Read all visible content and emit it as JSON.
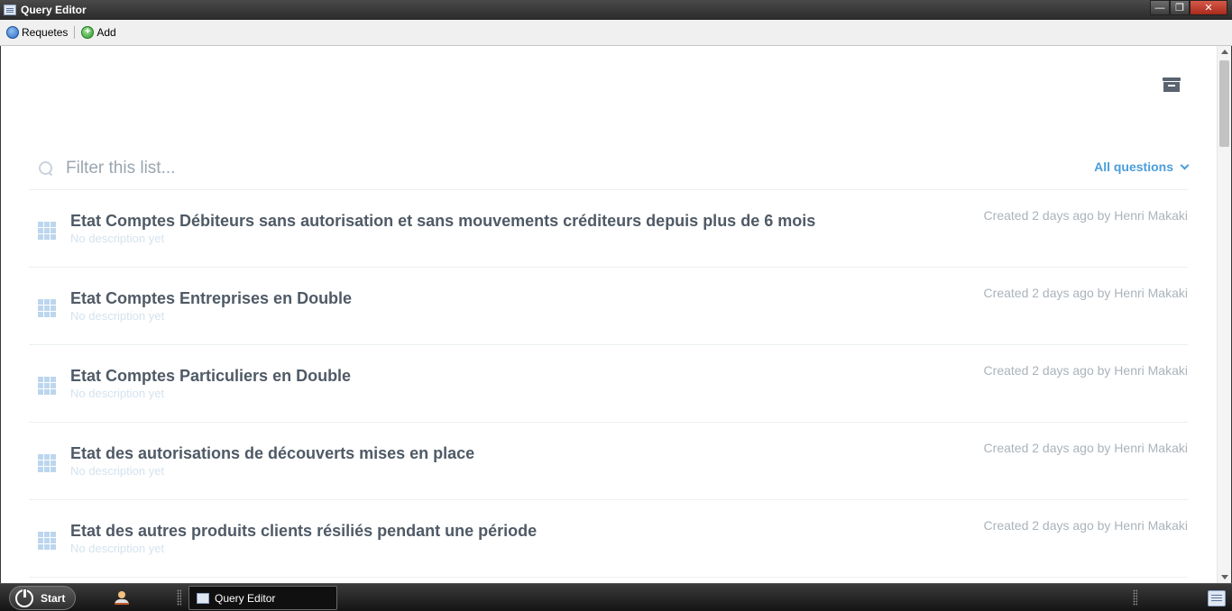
{
  "window": {
    "title": "Query Editor",
    "controls": {
      "minimize": "—",
      "restore": "❐",
      "close": "✕"
    }
  },
  "toolbar": {
    "refresh_label": "Requetes",
    "add_label": "Add",
    "add_glyph": "+"
  },
  "filter": {
    "placeholder": "Filter this list...",
    "dropdown_label": "All questions"
  },
  "questions": [
    {
      "title": "Etat Comptes Débiteurs sans autorisation et sans mouvements créditeurs depuis plus de 6 mois",
      "description": "No description yet",
      "meta": "Created 2 days ago by Henri Makaki"
    },
    {
      "title": "Etat Comptes Entreprises en Double",
      "description": "No description yet",
      "meta": "Created 2 days ago by Henri Makaki"
    },
    {
      "title": "Etat Comptes Particuliers en Double",
      "description": "No description yet",
      "meta": "Created 2 days ago by Henri Makaki"
    },
    {
      "title": "Etat des autorisations de découverts mises en place",
      "description": "No description yet",
      "meta": "Created 2 days ago by Henri Makaki"
    },
    {
      "title": "Etat des autres produits clients résiliés pendant une période",
      "description": "No description yet",
      "meta": "Created 2 days ago by Henri Makaki"
    }
  ],
  "taskbar": {
    "start_label": "Start",
    "task_label": "Query Editor"
  },
  "colors": {
    "accent": "#4a9edb",
    "title_text": "#4f5a66",
    "meta_text": "#aab3bb",
    "grid_icon": "#bcd6ee"
  }
}
